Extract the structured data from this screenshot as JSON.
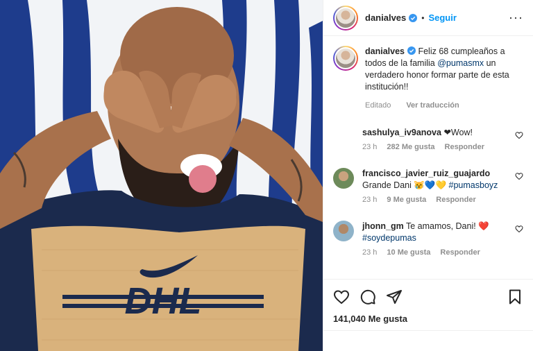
{
  "header": {
    "username": "danialves",
    "dot": "•",
    "follow_label": "Seguir",
    "more_label": "···"
  },
  "caption": {
    "username": "danialves",
    "text_before": "Feliz 68 cumpleaños a todos de la familia ",
    "mention": "@pumasmx",
    "text_after": " un verdadero honor formar parte de esta institución!!",
    "edited": "Editado",
    "translate": "Ver traducción"
  },
  "comments": [
    {
      "username": "sashulya_iv9anova",
      "text": "❤Wow!",
      "time": "23 h",
      "likes": "282 Me gusta",
      "reply": "Responder"
    },
    {
      "username": "francisco_javier_ruiz_guajardo",
      "text": "Grande Dani 😿💙💛 ",
      "hashtag": "#pumasboyz",
      "time": "23 h",
      "likes": "9 Me gusta",
      "reply": "Responder"
    },
    {
      "username": "jhonn_gm",
      "text": "Te amamos, Dani! ❤️",
      "hashtag": "#soydepumas",
      "time": "23 h",
      "likes": "10 Me gusta",
      "reply": "Responder"
    }
  ],
  "likes_count": "141,040 Me gusta",
  "icons": {
    "like": "heart-icon",
    "comment": "comment-icon",
    "share": "share-icon",
    "save": "bookmark-icon",
    "verified": "verified-badge-icon"
  },
  "colors": {
    "link": "#00376b",
    "follow": "#0095f6",
    "verified": "#3897f0",
    "jersey_navy": "#1b2a4d",
    "jersey_gold": "#d9b27c"
  },
  "image": {
    "logo_text": "DHL"
  }
}
